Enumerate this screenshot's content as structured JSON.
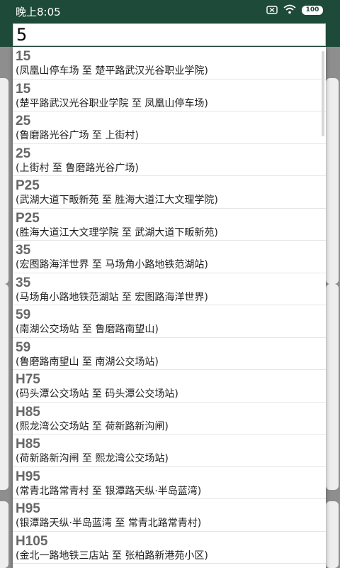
{
  "status": {
    "time": "晚上8:05",
    "battery": "100",
    "icons": [
      "close-box-icon",
      "wifi-icon",
      "battery-icon"
    ]
  },
  "search": {
    "value": "5"
  },
  "results": [
    {
      "route": "15",
      "desc": "(凤凰山停车场 至 楚平路武汉光谷职业学院)"
    },
    {
      "route": "15",
      "desc": "(楚平路武汉光谷职业学院 至 凤凰山停车场)"
    },
    {
      "route": "25",
      "desc": "(鲁磨路光谷广场 至 上街村)"
    },
    {
      "route": "25",
      "desc": "(上街村 至 鲁磨路光谷广场)"
    },
    {
      "route": "P25",
      "desc": "(武湖大道下畈新苑 至 胜海大道江大文理学院)"
    },
    {
      "route": "P25",
      "desc": "(胜海大道江大文理学院 至 武湖大道下畈新苑)"
    },
    {
      "route": "35",
      "desc": "(宏图路海洋世界 至 马场角小路地铁范湖站)"
    },
    {
      "route": "35",
      "desc": "(马场角小路地铁范湖站 至 宏图路海洋世界)"
    },
    {
      "route": "59",
      "desc": "(南湖公交场站 至 鲁磨路南望山)"
    },
    {
      "route": "59",
      "desc": "(鲁磨路南望山 至 南湖公交场站)"
    },
    {
      "route": "H75",
      "desc": "(码头潭公交场站 至 码头潭公交场站)"
    },
    {
      "route": "H85",
      "desc": "(熙龙湾公交场站 至 荷新路新沟闸)"
    },
    {
      "route": "H85",
      "desc": "(荷新路新沟闸 至 熙龙湾公交场站)"
    },
    {
      "route": "H95",
      "desc": "(常青北路常青村 至 银潭路天纵·半岛蓝湾)"
    },
    {
      "route": "H95",
      "desc": "(银潭路天纵·半岛蓝湾 至 常青北路常青村)"
    },
    {
      "route": "H105",
      "desc": "(金北一路地铁三店站 至 张柏路新港苑小区)"
    }
  ]
}
